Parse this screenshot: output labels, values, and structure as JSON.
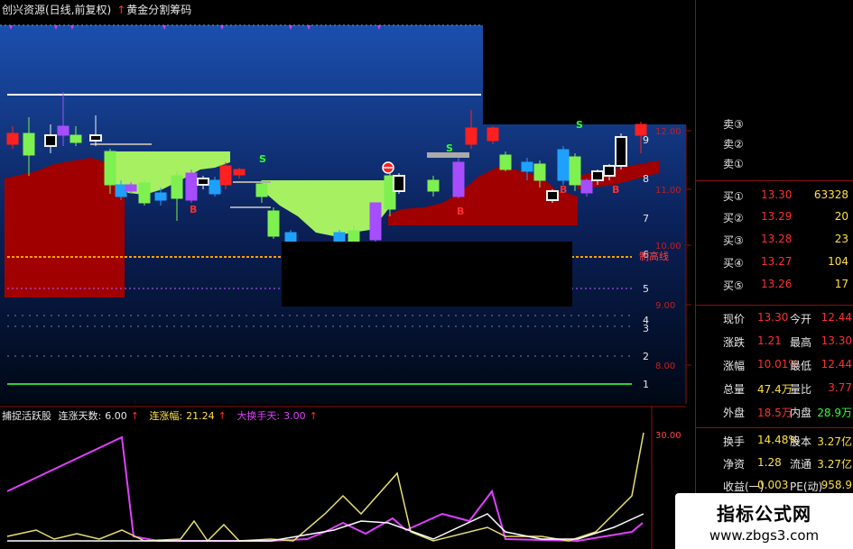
{
  "title_bar": {
    "stock_name": "创兴资源(日线,前复权)",
    "indicator_arrow": "↑",
    "indicator_name": "黄金分割筹码"
  },
  "main_chart": {
    "line_label": "制高线",
    "fib_numbers": [
      "9",
      "8",
      "7",
      "6",
      "5",
      "4",
      "3",
      "2",
      "1"
    ],
    "price_ticks": [
      "12.00",
      "11.00",
      "10.00",
      "9.00",
      "8.00"
    ],
    "signal_labels": [
      "S",
      "B",
      "S",
      "B",
      "B",
      "S",
      "B"
    ],
    "colors": {
      "bull": "#ff3030",
      "bear": "#00c8ff",
      "green_fill": "#a6f062",
      "red_fill": "#a00000",
      "blue_top": "#1a4aa8",
      "purple": "#a64dff"
    }
  },
  "indicator_bar": {
    "name": "捕捉活跃股",
    "items": [
      {
        "label": "连涨天数:",
        "value": "6.00",
        "arrow": "↑"
      },
      {
        "label": "连涨幅:",
        "value": "21.24",
        "arrow": "↑"
      },
      {
        "label": "大换手天:",
        "value": "3.00",
        "arrow": "↑"
      }
    ],
    "tick": "30.00"
  },
  "order_book": {
    "sell": [
      {
        "label": "卖③",
        "price": "",
        "vol": ""
      },
      {
        "label": "卖②",
        "price": "",
        "vol": ""
      },
      {
        "label": "卖①",
        "price": "",
        "vol": ""
      }
    ],
    "buy": [
      {
        "label": "买①",
        "price": "13.30",
        "vol": "63328"
      },
      {
        "label": "买②",
        "price": "13.29",
        "vol": "20"
      },
      {
        "label": "买③",
        "price": "13.28",
        "vol": "23"
      },
      {
        "label": "买④",
        "price": "13.27",
        "vol": "104"
      },
      {
        "label": "买⑤",
        "price": "13.26",
        "vol": "17"
      }
    ]
  },
  "quote": {
    "rows": [
      {
        "l1": "现价",
        "v1": "13.30",
        "l2": "今开",
        "v2": "12.44"
      },
      {
        "l1": "涨跌",
        "v1": "1.21",
        "l2": "最高",
        "v2": "13.30"
      },
      {
        "l1": "涨幅",
        "v1": "10.01%",
        "l2": "最低",
        "v2": "12.44"
      },
      {
        "l1": "总量",
        "v1": "47.4万",
        "l2": "量比",
        "v2": "3.77"
      },
      {
        "l1": "外盘",
        "v1": "18.5万",
        "l2": "内盘",
        "v2": "28.9万"
      }
    ],
    "rows2": [
      {
        "l1": "换手",
        "v1": "14.48%",
        "l2": "股本",
        "v2": "3.27亿"
      },
      {
        "l1": "净资",
        "v1": "1.28",
        "l2": "流通",
        "v2": "3.27亿"
      },
      {
        "l1": "收益(一)",
        "v1": "0.003",
        "l2": "PE(动)",
        "v2": "958.9"
      }
    ]
  },
  "watermark": {
    "title": "指标公式网",
    "url": "www.zbgs3.com"
  }
}
